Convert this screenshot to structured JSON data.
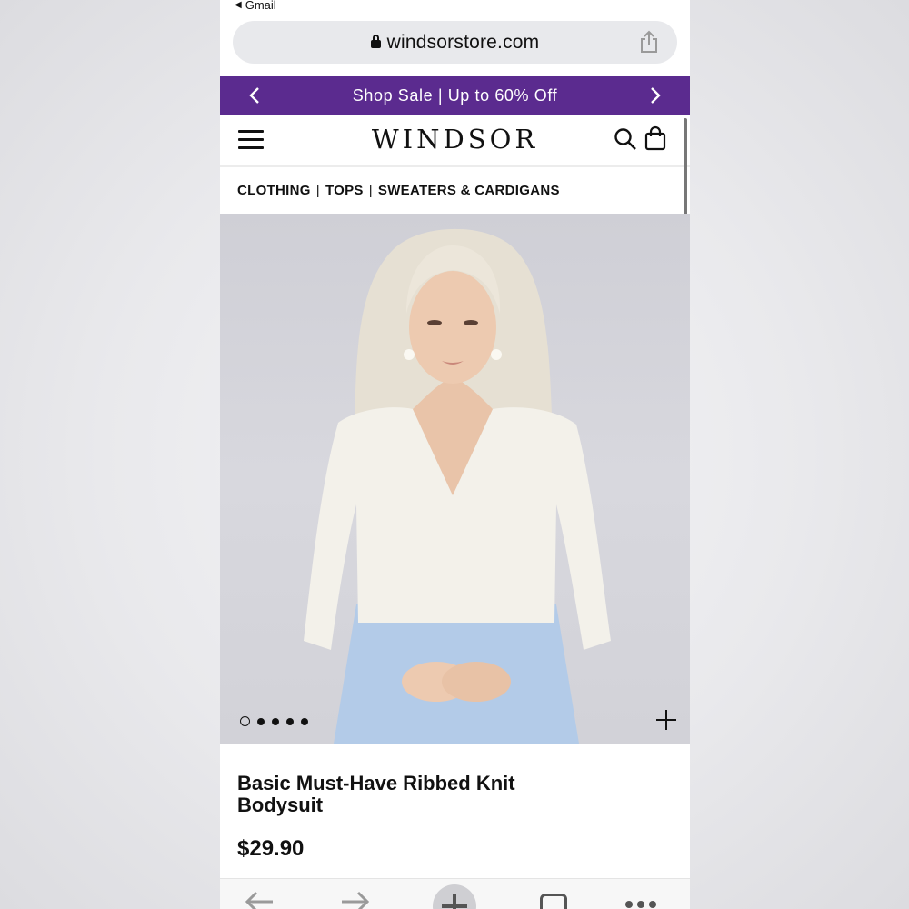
{
  "status": {
    "back_label": "Gmail"
  },
  "browser": {
    "url": "windsorstore.com"
  },
  "promo": {
    "text": "Shop Sale | Up to 60% Off"
  },
  "header": {
    "logo": "WINDSOR"
  },
  "breadcrumb": {
    "items": [
      "CLOTHING",
      "TOPS",
      "SWEATERS & CARDIGANS"
    ],
    "separator": "|"
  },
  "gallery": {
    "image_count": 5,
    "active_index": 0
  },
  "product": {
    "title": "Basic Must-Have Ribbed Knit Bodysuit",
    "price": "$29.90"
  },
  "colors": {
    "promo_bg": "#5b2b8f",
    "urlbar_bg": "#e8e9ec",
    "text": "#111111",
    "image_bg": "#d4d4da",
    "sweater": "#f3f1ea",
    "skirt": "#b3cbe8",
    "hair": "#e8e2d6"
  },
  "icons": [
    "lock-icon",
    "share-icon",
    "chevron-left-icon",
    "chevron-right-icon",
    "hamburger-icon",
    "search-icon",
    "bag-icon",
    "plus-icon",
    "back-arrow-icon",
    "forward-arrow-icon",
    "new-tab-icon",
    "tabs-icon",
    "more-icon"
  ]
}
